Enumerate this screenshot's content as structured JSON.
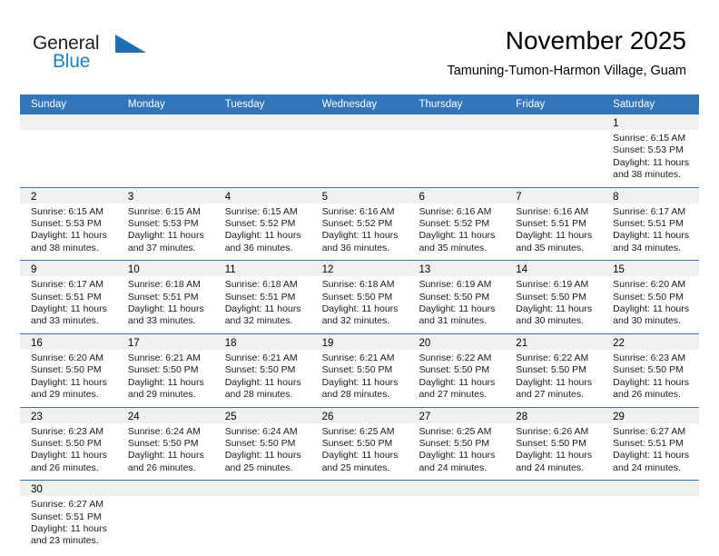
{
  "brand": {
    "name_part1": "General",
    "name_part2": "Blue",
    "flag_icon": "blue-triangle-flag-icon",
    "flag_color": "#1c6fb5"
  },
  "header": {
    "title": "November 2025",
    "subtitle": "Tamuning-Tumon-Harmon Village, Guam"
  },
  "colors": {
    "header_blue": "#3275bb",
    "brand_blue": "#1c80c6",
    "day_band_gray": "#f0f0f0",
    "text": "#000000"
  },
  "weekdays": [
    "Sunday",
    "Monday",
    "Tuesday",
    "Wednesday",
    "Thursday",
    "Friday",
    "Saturday"
  ],
  "weeks": [
    [
      {
        "empty": true
      },
      {
        "empty": true
      },
      {
        "empty": true
      },
      {
        "empty": true
      },
      {
        "empty": true
      },
      {
        "empty": true
      },
      {
        "day": "1",
        "sunrise": "Sunrise: 6:15 AM",
        "sunset": "Sunset: 5:53 PM",
        "daylight1": "Daylight: 11 hours",
        "daylight2": "and 38 minutes."
      }
    ],
    [
      {
        "day": "2",
        "sunrise": "Sunrise: 6:15 AM",
        "sunset": "Sunset: 5:53 PM",
        "daylight1": "Daylight: 11 hours",
        "daylight2": "and 38 minutes."
      },
      {
        "day": "3",
        "sunrise": "Sunrise: 6:15 AM",
        "sunset": "Sunset: 5:53 PM",
        "daylight1": "Daylight: 11 hours",
        "daylight2": "and 37 minutes."
      },
      {
        "day": "4",
        "sunrise": "Sunrise: 6:15 AM",
        "sunset": "Sunset: 5:52 PM",
        "daylight1": "Daylight: 11 hours",
        "daylight2": "and 36 minutes."
      },
      {
        "day": "5",
        "sunrise": "Sunrise: 6:16 AM",
        "sunset": "Sunset: 5:52 PM",
        "daylight1": "Daylight: 11 hours",
        "daylight2": "and 36 minutes."
      },
      {
        "day": "6",
        "sunrise": "Sunrise: 6:16 AM",
        "sunset": "Sunset: 5:52 PM",
        "daylight1": "Daylight: 11 hours",
        "daylight2": "and 35 minutes."
      },
      {
        "day": "7",
        "sunrise": "Sunrise: 6:16 AM",
        "sunset": "Sunset: 5:51 PM",
        "daylight1": "Daylight: 11 hours",
        "daylight2": "and 35 minutes."
      },
      {
        "day": "8",
        "sunrise": "Sunrise: 6:17 AM",
        "sunset": "Sunset: 5:51 PM",
        "daylight1": "Daylight: 11 hours",
        "daylight2": "and 34 minutes."
      }
    ],
    [
      {
        "day": "9",
        "sunrise": "Sunrise: 6:17 AM",
        "sunset": "Sunset: 5:51 PM",
        "daylight1": "Daylight: 11 hours",
        "daylight2": "and 33 minutes."
      },
      {
        "day": "10",
        "sunrise": "Sunrise: 6:18 AM",
        "sunset": "Sunset: 5:51 PM",
        "daylight1": "Daylight: 11 hours",
        "daylight2": "and 33 minutes."
      },
      {
        "day": "11",
        "sunrise": "Sunrise: 6:18 AM",
        "sunset": "Sunset: 5:51 PM",
        "daylight1": "Daylight: 11 hours",
        "daylight2": "and 32 minutes."
      },
      {
        "day": "12",
        "sunrise": "Sunrise: 6:18 AM",
        "sunset": "Sunset: 5:50 PM",
        "daylight1": "Daylight: 11 hours",
        "daylight2": "and 32 minutes."
      },
      {
        "day": "13",
        "sunrise": "Sunrise: 6:19 AM",
        "sunset": "Sunset: 5:50 PM",
        "daylight1": "Daylight: 11 hours",
        "daylight2": "and 31 minutes."
      },
      {
        "day": "14",
        "sunrise": "Sunrise: 6:19 AM",
        "sunset": "Sunset: 5:50 PM",
        "daylight1": "Daylight: 11 hours",
        "daylight2": "and 30 minutes."
      },
      {
        "day": "15",
        "sunrise": "Sunrise: 6:20 AM",
        "sunset": "Sunset: 5:50 PM",
        "daylight1": "Daylight: 11 hours",
        "daylight2": "and 30 minutes."
      }
    ],
    [
      {
        "day": "16",
        "sunrise": "Sunrise: 6:20 AM",
        "sunset": "Sunset: 5:50 PM",
        "daylight1": "Daylight: 11 hours",
        "daylight2": "and 29 minutes."
      },
      {
        "day": "17",
        "sunrise": "Sunrise: 6:21 AM",
        "sunset": "Sunset: 5:50 PM",
        "daylight1": "Daylight: 11 hours",
        "daylight2": "and 29 minutes."
      },
      {
        "day": "18",
        "sunrise": "Sunrise: 6:21 AM",
        "sunset": "Sunset: 5:50 PM",
        "daylight1": "Daylight: 11 hours",
        "daylight2": "and 28 minutes."
      },
      {
        "day": "19",
        "sunrise": "Sunrise: 6:21 AM",
        "sunset": "Sunset: 5:50 PM",
        "daylight1": "Daylight: 11 hours",
        "daylight2": "and 28 minutes."
      },
      {
        "day": "20",
        "sunrise": "Sunrise: 6:22 AM",
        "sunset": "Sunset: 5:50 PM",
        "daylight1": "Daylight: 11 hours",
        "daylight2": "and 27 minutes."
      },
      {
        "day": "21",
        "sunrise": "Sunrise: 6:22 AM",
        "sunset": "Sunset: 5:50 PM",
        "daylight1": "Daylight: 11 hours",
        "daylight2": "and 27 minutes."
      },
      {
        "day": "22",
        "sunrise": "Sunrise: 6:23 AM",
        "sunset": "Sunset: 5:50 PM",
        "daylight1": "Daylight: 11 hours",
        "daylight2": "and 26 minutes."
      }
    ],
    [
      {
        "day": "23",
        "sunrise": "Sunrise: 6:23 AM",
        "sunset": "Sunset: 5:50 PM",
        "daylight1": "Daylight: 11 hours",
        "daylight2": "and 26 minutes."
      },
      {
        "day": "24",
        "sunrise": "Sunrise: 6:24 AM",
        "sunset": "Sunset: 5:50 PM",
        "daylight1": "Daylight: 11 hours",
        "daylight2": "and 26 minutes."
      },
      {
        "day": "25",
        "sunrise": "Sunrise: 6:24 AM",
        "sunset": "Sunset: 5:50 PM",
        "daylight1": "Daylight: 11 hours",
        "daylight2": "and 25 minutes."
      },
      {
        "day": "26",
        "sunrise": "Sunrise: 6:25 AM",
        "sunset": "Sunset: 5:50 PM",
        "daylight1": "Daylight: 11 hours",
        "daylight2": "and 25 minutes."
      },
      {
        "day": "27",
        "sunrise": "Sunrise: 6:25 AM",
        "sunset": "Sunset: 5:50 PM",
        "daylight1": "Daylight: 11 hours",
        "daylight2": "and 24 minutes."
      },
      {
        "day": "28",
        "sunrise": "Sunrise: 6:26 AM",
        "sunset": "Sunset: 5:50 PM",
        "daylight1": "Daylight: 11 hours",
        "daylight2": "and 24 minutes."
      },
      {
        "day": "29",
        "sunrise": "Sunrise: 6:27 AM",
        "sunset": "Sunset: 5:51 PM",
        "daylight1": "Daylight: 11 hours",
        "daylight2": "and 24 minutes."
      }
    ],
    [
      {
        "day": "30",
        "sunrise": "Sunrise: 6:27 AM",
        "sunset": "Sunset: 5:51 PM",
        "daylight1": "Daylight: 11 hours",
        "daylight2": "and 23 minutes."
      },
      {
        "empty": true
      },
      {
        "empty": true
      },
      {
        "empty": true
      },
      {
        "empty": true
      },
      {
        "empty": true
      },
      {
        "empty": true
      }
    ]
  ]
}
